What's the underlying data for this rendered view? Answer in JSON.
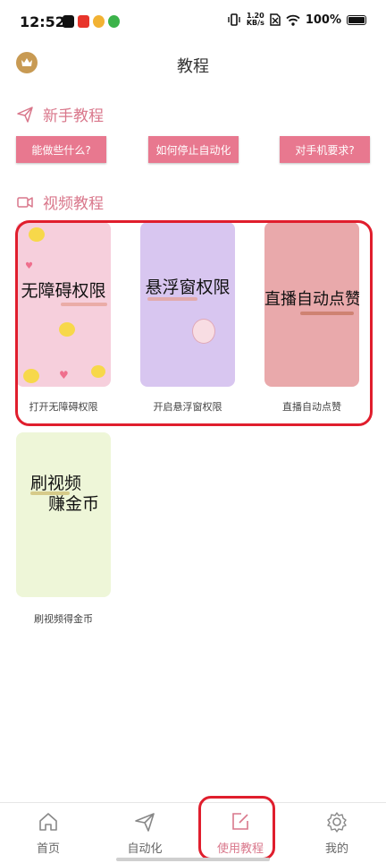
{
  "status_bar": {
    "time": "12:52",
    "net_speed_value": "1.20",
    "net_speed_unit": "KB/s",
    "battery": "100%"
  },
  "header": {
    "title": "教程",
    "avatar_icon": "crown-icon"
  },
  "newbie": {
    "title": "新手教程",
    "buttons": [
      "能做些什么?",
      "如何停止自动化",
      "对手机要求?"
    ]
  },
  "videos": {
    "title": "视频教程",
    "cards": [
      {
        "title": "无障碍权限",
        "caption": "打开无障碍权限",
        "bg": "#f6cfdc"
      },
      {
        "title": "悬浮窗权限",
        "caption": "开启悬浮窗权限",
        "bg": "#d8c6f0"
      },
      {
        "title": "直播自动点赞",
        "caption": "直播自动点赞",
        "bg": "#e9a9ab"
      },
      {
        "title_line1": "刷视频",
        "title_line2": "赚金币",
        "caption": "刷视频得金币",
        "bg": "#eef6d8"
      }
    ]
  },
  "bottom_nav": {
    "items": [
      {
        "label": "首页",
        "icon": "home-icon"
      },
      {
        "label": "自动化",
        "icon": "paper-plane-icon"
      },
      {
        "label": "使用教程",
        "icon": "edit-icon",
        "active": true
      },
      {
        "label": "我的",
        "icon": "gear-icon"
      }
    ]
  },
  "colors": {
    "accent": "#d9778b",
    "button": "#e8788f",
    "highlight": "#e01e2d"
  }
}
